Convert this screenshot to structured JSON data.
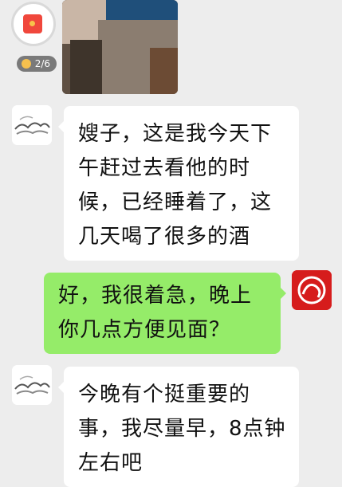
{
  "red_packet": {
    "progress": "2/6",
    "icon": "red-packet-icon"
  },
  "messages": [
    {
      "sender": "contact",
      "text": "嫂子，这是我今天下午赶过去看他的时候，已经睡着了，这几天喝了很多的酒"
    },
    {
      "sender": "me",
      "text": "好，我很着急，晚上你几点方便见面？"
    },
    {
      "sender": "contact",
      "text": "今晚有个挺重要的事，我尽量早，8点钟左右吧"
    }
  ],
  "colors": {
    "chat_background": "#ededed",
    "incoming_bubble": "#ffffff",
    "outgoing_bubble": "#95ec69"
  }
}
